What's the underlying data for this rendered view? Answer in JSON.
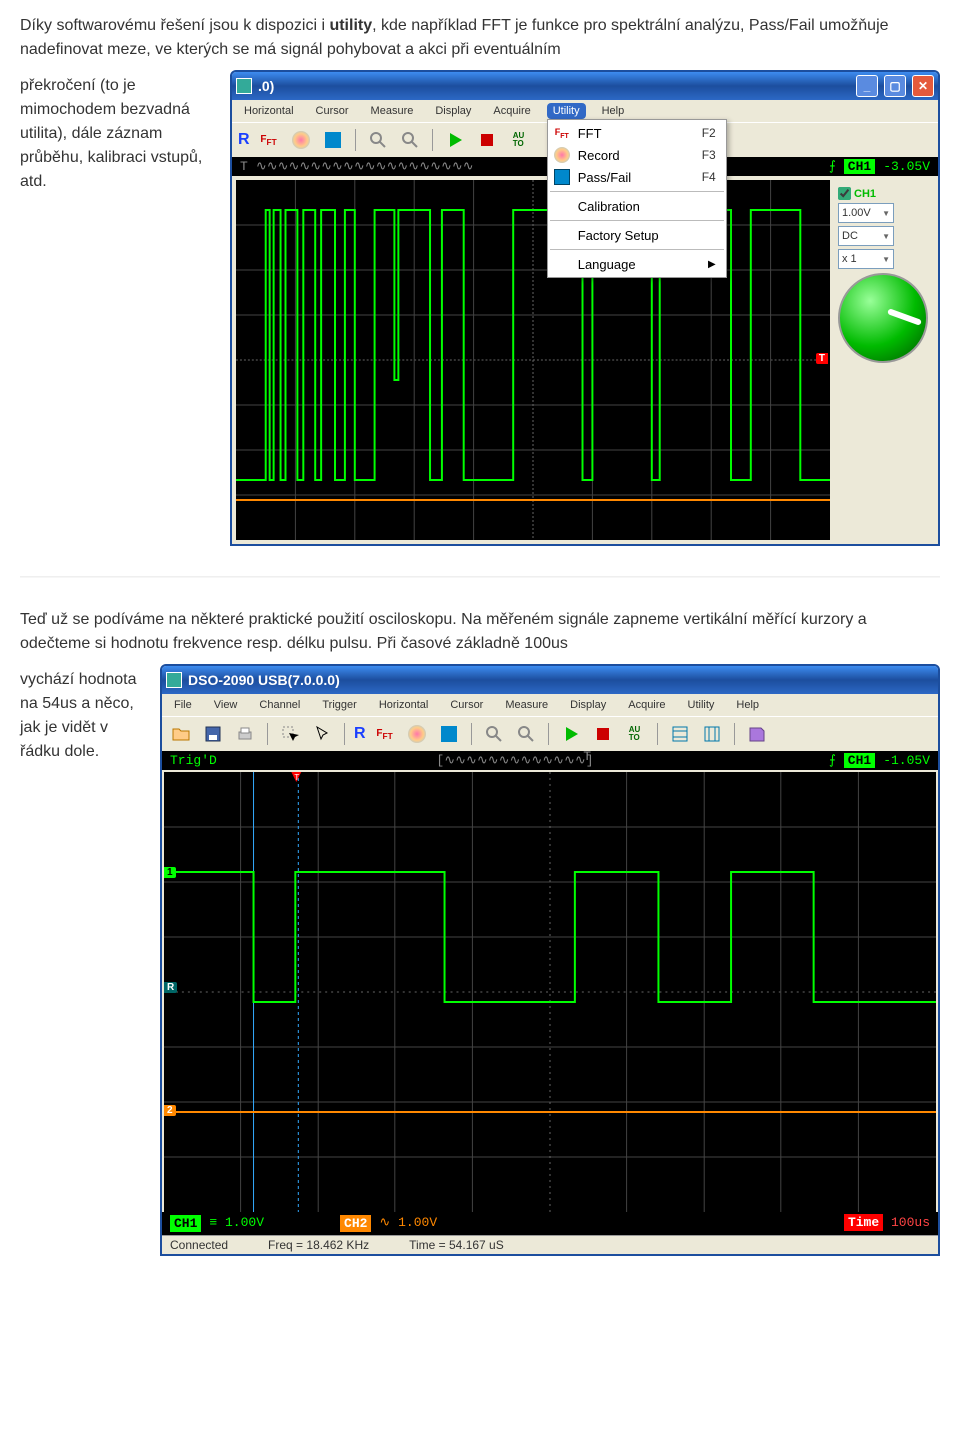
{
  "para1_parts": {
    "p1": "Díky softwarovému řešení jsou k dispozici i ",
    "bold1": "utility",
    "p2": ", kde například FFT je funkce pro spektrální analýzu, Pass/Fail umožňuje nadefinovat meze, ve kterých se má signál pohybovat a akci při eventuálním"
  },
  "para1_left": "překročení (to je mimochodem bezvadná utilita), dále záznam průběhu, kalibraci vstupů, atd.",
  "para2_text": "Teď už se podíváme na některé praktické použití osciloskopu. Na měřeném signále zapneme vertikální měřící kurzory a odečteme si hodnotu frekvence resp. délku pulsu. Při časové základně 100us",
  "para2_left": "vychází hodnota na 54us a něco, jak je vidět v řádku dole.",
  "win1": {
    "title_suffix": ".0)",
    "menus": [
      "Horizontal",
      "Cursor",
      "Measure",
      "Display",
      "Acquire",
      "Utility",
      "Help"
    ],
    "utility_menu": {
      "items": [
        {
          "icon": "fft",
          "label": "FFT",
          "key": "F2"
        },
        {
          "icon": "rec",
          "label": "Record",
          "key": "F3"
        },
        {
          "icon": "pf",
          "label": "Pass/Fail",
          "key": "F4"
        }
      ],
      "items2": [
        {
          "label": "Calibration"
        },
        {
          "label": "Factory Setup"
        },
        {
          "label": "Language",
          "submenu": true
        }
      ]
    },
    "r_label": "R",
    "auto_label": "AU\nTO",
    "side": {
      "ch": "CH1",
      "vdiv": "1.00V",
      "coupling": "DC",
      "mult": "x 1"
    },
    "trigbar": {
      "ch": "CH1",
      "v": "-3.05V"
    }
  },
  "win2": {
    "title": "DSO-2090 USB(7.0.0.0)",
    "menus": [
      "File",
      "View",
      "Channel",
      "Trigger",
      "Horizontal",
      "Cursor",
      "Measure",
      "Display",
      "Acquire",
      "Utility",
      "Help"
    ],
    "r_label": "R",
    "auto_label": "AU\nTO",
    "trigbar": {
      "status": "Trig'D",
      "ch": "CH1",
      "v": "-1.05V"
    },
    "status": {
      "ch1": "CH1",
      "ch1v": "≡ 1.00V",
      "ch2": "CH2",
      "ch2v": "∿ 1.00V",
      "time_lbl": "Time",
      "time_v": "100us"
    },
    "statusbar": {
      "conn": "Connected",
      "freq": "Freq = 18.462 KHz",
      "time": "Time = 54.167 uS"
    }
  }
}
